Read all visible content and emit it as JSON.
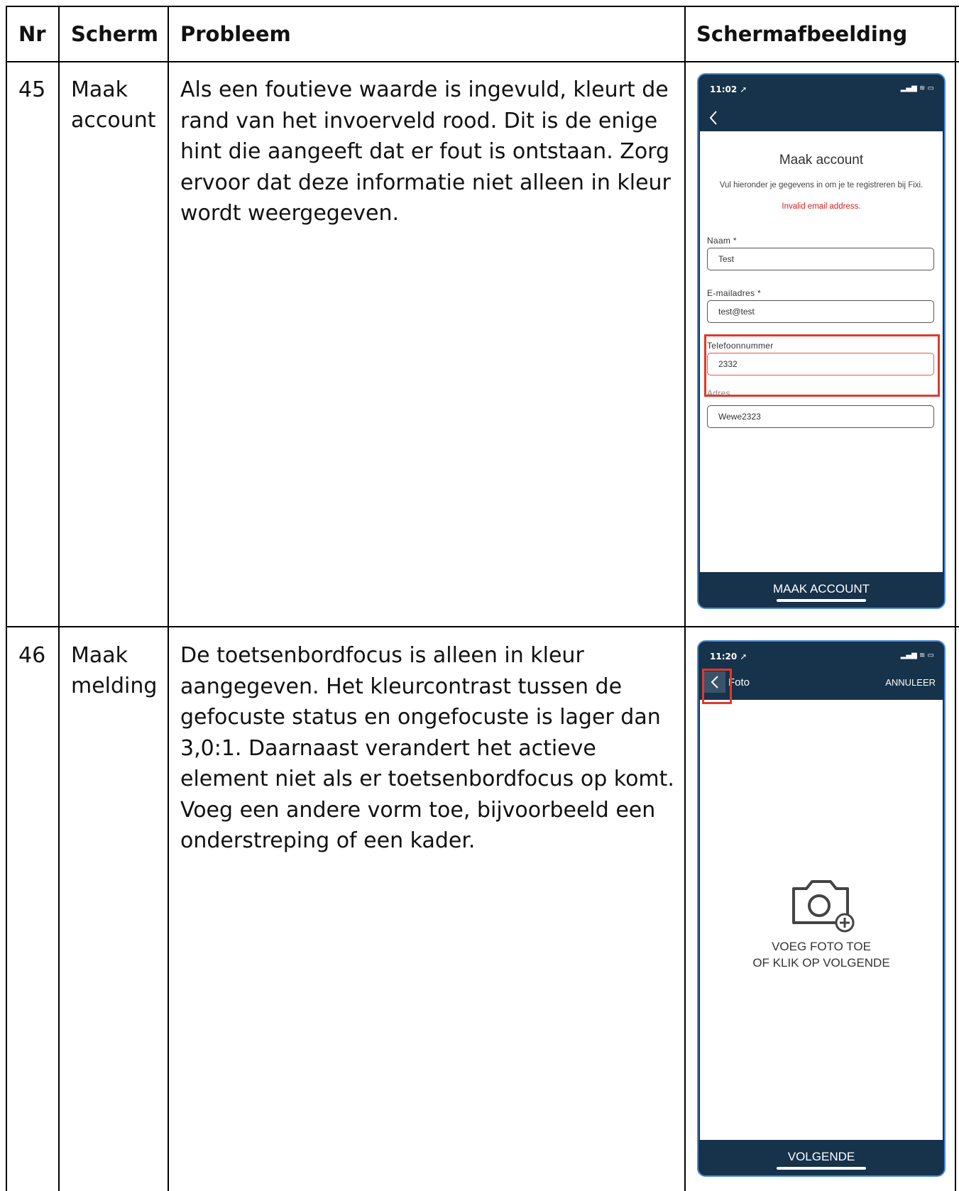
{
  "table": {
    "headers": [
      "Nr",
      "Scherm",
      "Probleem",
      "Schermafbeelding"
    ],
    "rows": [
      {
        "nr": "45",
        "scherm": [
          "Maak",
          "account"
        ],
        "probleem": [
          "Als een foutieve waarde is ingevuld, kleurt de",
          "rand van het invoerveld rood. Dit is de enige",
          "hint die aangeeft dat er fout is ontstaan. Zorg",
          "ervoor dat deze informatie niet alleen in kleur",
          "wordt weergegeven."
        ],
        "screenshot": {
          "time": "11:02",
          "back_icon": "chevron-left-icon",
          "title": "Maak account",
          "subtitle": "Vul hieronder je gegevens in om je te registreren bij Fixi.",
          "error": "Invalid email address.",
          "fields": [
            {
              "label": "Naam *",
              "value": "Test"
            },
            {
              "label": "E-mailadres *",
              "value": "test@test"
            },
            {
              "label": "Telefoonnummer",
              "value": "2332"
            },
            {
              "label": "Adres",
              "value": "Wewe2323"
            }
          ],
          "button": "MAAK ACCOUNT",
          "highlight_color": "#e03a2a",
          "error_color": "#d02020"
        }
      },
      {
        "nr": "46",
        "scherm": [
          "Maak",
          "melding"
        ],
        "probleem": [
          "De toetsenbordfocus is alleen in kleur",
          "aangegeven. Het kleurcontrast tussen de",
          "gefocuste status en ongefocuste is lager dan",
          "3,0:1. Daarnaast verandert het actieve",
          "element niet als er toetsenbordfocus op komt.",
          "Voeg een andere vorm toe, bijvoorbeeld een",
          "onderstreping of een kader."
        ],
        "screenshot": {
          "time": "11:20",
          "back_icon": "chevron-left-icon",
          "nav_title": "Foto",
          "cancel": "ANNULEER",
          "camera_icon": "camera-plus-icon",
          "prompt": [
            "VOEG FOTO TOE",
            "OF KLIK OP VOLGENDE"
          ],
          "button": "VOLGENDE",
          "app_color": "#17324b"
        }
      }
    ]
  }
}
